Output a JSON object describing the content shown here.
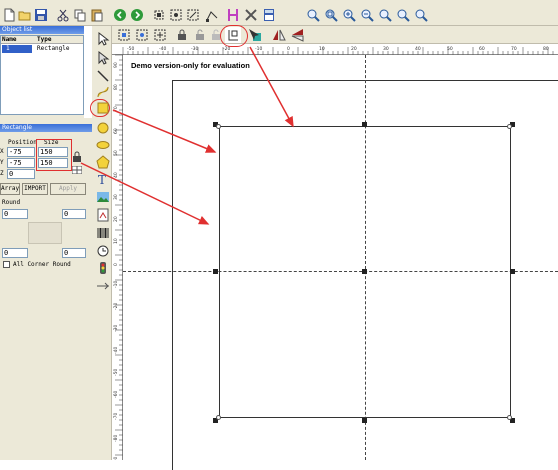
{
  "object_list": {
    "title": "Object list",
    "headers": [
      "Name",
      "Type"
    ],
    "rows": [
      {
        "name": "1",
        "type": "Rectangle"
      }
    ]
  },
  "properties": {
    "title": "Rectangle",
    "position_label": "Position",
    "size_label": "Size",
    "x_label": "X",
    "y_label": "Y",
    "z_label": "Z",
    "pos_x": "-75",
    "pos_y": "-75",
    "pos_z": "0",
    "size_w": "150",
    "size_h": "150",
    "array_button": "Array",
    "import_button": "IMPORT",
    "apply_button": "Apply",
    "round_label": "Round",
    "round_tl": "0",
    "round_tr": "0",
    "round_bl": "0",
    "round_br": "0",
    "all_corner_round": "All Corner Round"
  },
  "canvas": {
    "watermark": "Demo version-only for evaluation",
    "top_ruler_labels": [
      "-50",
      "-40",
      "-30",
      "-20",
      "-10",
      "0",
      "10",
      "20",
      "30",
      "40",
      "50",
      "60",
      "70",
      "80"
    ],
    "left_ruler_labels": [
      "90",
      "80",
      "70",
      "60",
      "50",
      "40",
      "30",
      "20",
      "10",
      "0",
      "-10",
      "-20",
      "-30",
      "-40",
      "-50",
      "-60",
      "-70",
      "-80",
      "-90"
    ]
  },
  "annotation_color": "#e03030",
  "selection_color": "#222222"
}
